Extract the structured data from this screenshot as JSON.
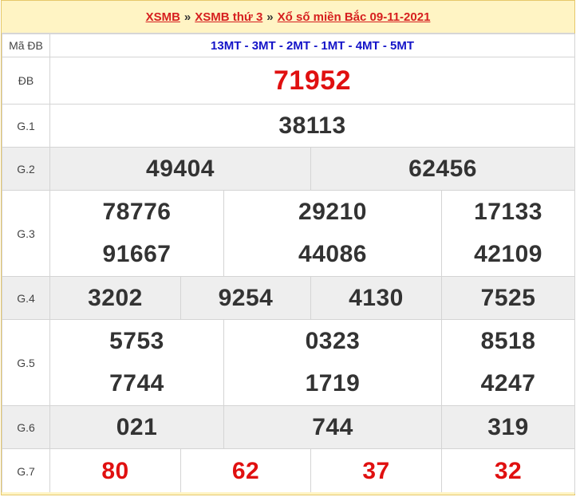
{
  "header": {
    "crumb1": "XSMB",
    "crumb2": "XSMB thứ 3",
    "crumb3": "Xổ số miền Bắc 09-11-2021",
    "separator": "»"
  },
  "rows": {
    "madb": {
      "label": "Mã ĐB",
      "value": "13MT - 3MT - 2MT - 1MT - 4MT - 5MT"
    },
    "db": {
      "label": "ĐB",
      "value": "71952"
    },
    "g1": {
      "label": "G.1",
      "values": [
        "38113"
      ]
    },
    "g2": {
      "label": "G.2",
      "values": [
        "49404",
        "62456"
      ]
    },
    "g3": {
      "label": "G.3",
      "values": [
        "78776",
        "29210",
        "17133",
        "91667",
        "44086",
        "42109"
      ]
    },
    "g4": {
      "label": "G.4",
      "values": [
        "3202",
        "9254",
        "4130",
        "7525"
      ]
    },
    "g5": {
      "label": "G.5",
      "values": [
        "5753",
        "0323",
        "8518",
        "7744",
        "1719",
        "4247"
      ]
    },
    "g6": {
      "label": "G.6",
      "values": [
        "021",
        "744",
        "319"
      ]
    },
    "g7": {
      "label": "G.7",
      "values": [
        "80",
        "62",
        "37",
        "32"
      ]
    }
  },
  "colors": {
    "header_bg": "#fff4c4",
    "link_red": "#d61f1f",
    "code_blue": "#1414c8",
    "number_red": "#e01010",
    "row_grey": "#eeeeee"
  }
}
